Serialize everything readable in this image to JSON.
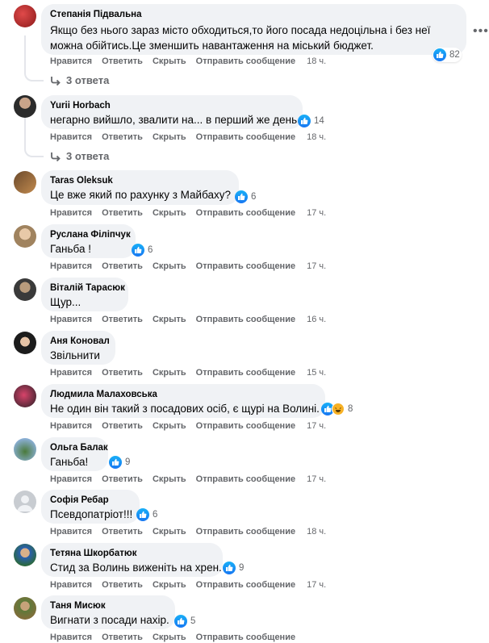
{
  "comments": [
    {
      "author": "Степанія Підвальна",
      "text": "Якщо без нього зараз місто обходиться,то його посада недоцільна і без неї можна обійтись.Це зменшить навантаження на міський бюджет.",
      "reactions": "82",
      "time": "18 ч.",
      "replies": "3 ответа"
    },
    {
      "author": "Yurii Horbach",
      "text": "негарно вийшло, звалити на... в перший же день",
      "reactions": "14",
      "time": "18 ч.",
      "replies": "3 ответа"
    },
    {
      "author": "Taras Oleksuk",
      "text": "Це вже який по рахунку з Майбаху?",
      "reactions": "6",
      "time": "17 ч."
    },
    {
      "author": "Руслана Філіпчук",
      "text": "Ганьба !",
      "reactions": "6",
      "time": "17 ч."
    },
    {
      "author": "Віталій Тарасюк",
      "text": "Щур...",
      "time": "16 ч."
    },
    {
      "author": "Аня Коновал",
      "text": "Звільнити",
      "time": "15 ч."
    },
    {
      "author": "Людмила Малаховська",
      "text": "Не один він такий з посадових осіб, є щурі на Волині.",
      "reactions": "8",
      "time": "17 ч."
    },
    {
      "author": "Ольга Балак",
      "text": "Ганьба!",
      "reactions": "9",
      "time": "17 ч."
    },
    {
      "author": "Софія Ребар",
      "text": "Псевдопатріот!!!",
      "reactions": "6",
      "time": "18 ч."
    },
    {
      "author": "Тетяна Шкорбатюк",
      "text": "Стид за Волинь виженіть на хрен.",
      "reactions": "9",
      "time": "17 ч."
    },
    {
      "author": "Таня Мисюк",
      "text": "Вигнати з посади нахір.",
      "reactions": "5",
      "time": ""
    }
  ],
  "actions": {
    "like": "Нравится",
    "reply": "Ответить",
    "hide": "Скрыть",
    "send": "Отправить сообщение"
  },
  "icons": {
    "like": "thumbs-up-icon",
    "haha": "haha-icon",
    "reply_arrow": "reply-arrow-icon",
    "more": "more-options-icon"
  },
  "colors": {
    "like_blue": "#1877f2",
    "bubble_bg": "#f0f2f5",
    "meta_gray": "#65676b"
  }
}
